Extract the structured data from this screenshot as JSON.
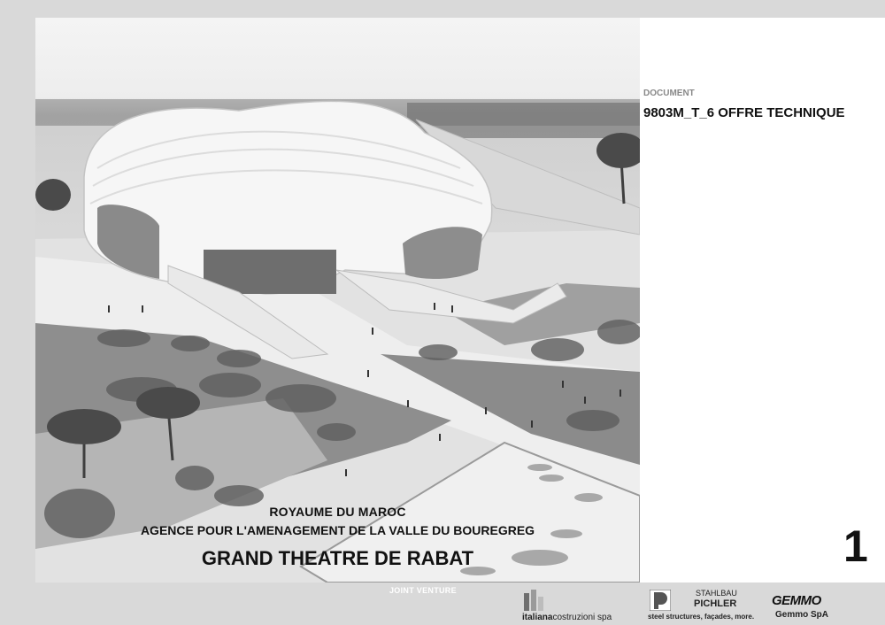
{
  "document": {
    "label": "DOCUMENT",
    "code": "9803M_T_6  OFFRE TECHNIQUE"
  },
  "cover": {
    "country": "ROYAUME DU MAROC",
    "agency": "AGENCE POUR L'AMENAGEMENT DE LA VALLE DU BOUREGREG",
    "project": "GRAND THEATRE DE RABAT"
  },
  "page_number": "1",
  "footer": {
    "joint_venture_label": "JOINT VENTURE",
    "partners": {
      "italiana_bold": "italiana",
      "italiana_rest": "costruzioni spa",
      "pichler_line1": "STAHLBAU",
      "pichler_line2": "PICHLER",
      "pichler_tagline": "steel structures, façades, more.",
      "gemmo_logo": "GEMMO",
      "gemmo_name": "Gemmo SpA"
    }
  },
  "colors": {
    "background": "#d9d9d9",
    "sheet": "#ffffff",
    "text": "#111111",
    "muted_label": "#888888"
  }
}
